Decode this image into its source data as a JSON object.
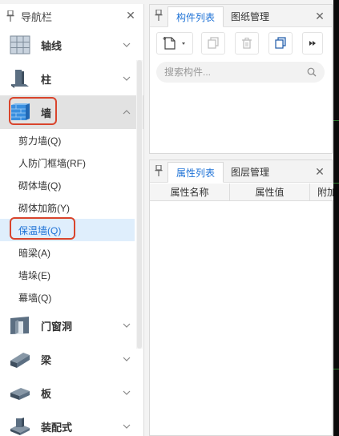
{
  "nav": {
    "title": "导航栏",
    "categories": [
      {
        "label": "轴线",
        "icon": "grid-icon",
        "expanded": false
      },
      {
        "label": "柱",
        "icon": "column-icon",
        "expanded": false
      },
      {
        "label": "墙",
        "icon": "wall-icon",
        "expanded": true
      },
      {
        "label": "门窗洞",
        "icon": "door-window-icon",
        "expanded": false
      },
      {
        "label": "梁",
        "icon": "beam-icon",
        "expanded": false
      },
      {
        "label": "板",
        "icon": "slab-icon",
        "expanded": false
      },
      {
        "label": "装配式",
        "icon": "prefab-icon",
        "expanded": false
      }
    ],
    "wall_items": [
      "剪力墙(Q)",
      "人防门框墙(RF)",
      "砌体墙(Q)",
      "砌体加筋(Y)",
      "保温墙(Q)",
      "暗梁(A)",
      "墙垛(E)",
      "幕墙(Q)"
    ],
    "selected_item": "保温墙(Q)"
  },
  "component_panel": {
    "tabs": [
      "构件列表",
      "图纸管理"
    ],
    "active_tab": "构件列表",
    "search_placeholder": "搜索构件..."
  },
  "attribute_panel": {
    "tabs": [
      "属性列表",
      "图层管理"
    ],
    "active_tab": "属性列表",
    "columns": [
      "属性名称",
      "属性值",
      "附加"
    ]
  },
  "colors": {
    "accent": "#1e72d6",
    "highlight": "#d9442c",
    "selected_bg": "#dfeefc",
    "expanded_bg": "#e2e2e2"
  }
}
